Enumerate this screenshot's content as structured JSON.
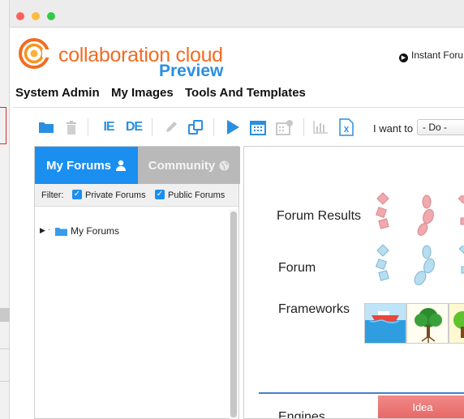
{
  "app": {
    "brand": "collaboration cloud",
    "brand_sub": "Preview",
    "instant_link": "Instant Foru"
  },
  "menu": {
    "items": [
      "System Admin",
      "My Images",
      "Tools And Templates"
    ]
  },
  "toolbar": {
    "ie_label": "IE",
    "de_label": "DE",
    "want_label": "I want to",
    "want_value": "- Do -",
    "icons": [
      "folder-icon",
      "trash-icon",
      "ie-icon",
      "de-icon",
      "pencil-icon",
      "duplicate-icon",
      "play-icon",
      "calendar-icon",
      "group-calendar-icon",
      "bar-chart-icon",
      "excel-icon"
    ]
  },
  "left_panel": {
    "tab_active": "My Forums",
    "tab_inactive": "Community",
    "filter_label": "Filter:",
    "filters": [
      {
        "label": "Private Forums",
        "checked": true
      },
      {
        "label": "Public Forums",
        "checked": true
      }
    ],
    "tree": [
      {
        "label": "My Forums",
        "icon": "folder-icon",
        "collapsed": true
      }
    ]
  },
  "right_panel": {
    "rows": [
      "Forum Results",
      "Forum",
      "Frameworks"
    ],
    "bottom_label": "Engines",
    "idea_button": "Idea"
  },
  "colors": {
    "brand_orange": "#f26c22",
    "accent_blue": "#1a8ff0",
    "idea_red": "#e66664",
    "tab_inactive": "#b9b9b9"
  }
}
